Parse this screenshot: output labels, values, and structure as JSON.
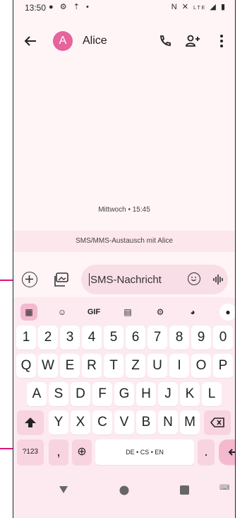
{
  "status_bar": {
    "time": "13:50",
    "left_icons": [
      "message-icon",
      "settings-icon",
      "upload-icon",
      "dot-icon"
    ],
    "right_icons": [
      "nfc-icon",
      "mute-icon",
      "lte-icon",
      "signal-icon",
      "battery-icon"
    ],
    "lte_label": "LTE"
  },
  "app_bar": {
    "avatar_letter": "A",
    "contact_name": "Alice"
  },
  "conversation": {
    "date_label": "Mittwoch • 15:45",
    "sms_note": "SMS/MMS-Austausch mit Alice"
  },
  "compose": {
    "placeholder": "SMS-Nachricht"
  },
  "keyboard": {
    "toolbar": {
      "gif_label": "GIF"
    },
    "rows": [
      [
        "1",
        "2",
        "3",
        "4",
        "5",
        "6",
        "7",
        "8",
        "9",
        "0"
      ],
      [
        "Q",
        "W",
        "E",
        "R",
        "T",
        "Z",
        "U",
        "I",
        "O",
        "P"
      ],
      [
        "A",
        "S",
        "D",
        "F",
        "G",
        "H",
        "J",
        "K",
        "L"
      ],
      [
        "Y",
        "X",
        "C",
        "V",
        "B",
        "N",
        "M"
      ]
    ],
    "symbols_key": "?123",
    "comma_key": ",",
    "space_key": "DE • CS • EN",
    "period_key": ".",
    "colors": {
      "accent": "#e5649b",
      "enter_background": "#f4b9cf"
    }
  },
  "callout_color": "#e0137a"
}
